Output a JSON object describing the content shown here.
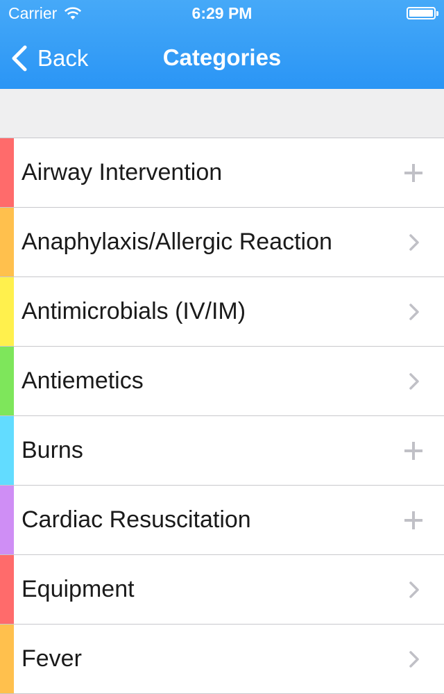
{
  "status_bar": {
    "carrier": "Carrier",
    "time": "6:29 PM"
  },
  "nav": {
    "back_label": "Back",
    "title": "Categories"
  },
  "rows": [
    {
      "label": "Airway Intervention",
      "color": "#ff6b6b",
      "accessory": "plus-icon"
    },
    {
      "label": "Anaphylaxis/Allergic Reaction",
      "color": "#ffc04d",
      "accessory": "chevron-right-icon"
    },
    {
      "label": "Antimicrobials (IV/IM)",
      "color": "#fff04d",
      "accessory": "chevron-right-icon"
    },
    {
      "label": "Antiemetics",
      "color": "#7ee65b",
      "accessory": "chevron-right-icon"
    },
    {
      "label": "Burns",
      "color": "#62dcff",
      "accessory": "plus-icon"
    },
    {
      "label": "Cardiac Resuscitation",
      "color": "#cf8ef5",
      "accessory": "plus-icon"
    },
    {
      "label": "Equipment",
      "color": "#ff6b6b",
      "accessory": "chevron-right-icon"
    },
    {
      "label": "Fever",
      "color": "#ffc04d",
      "accessory": "chevron-right-icon"
    }
  ],
  "colors": {
    "header": "#2a95f5",
    "accessory": "#c0c0c6"
  }
}
